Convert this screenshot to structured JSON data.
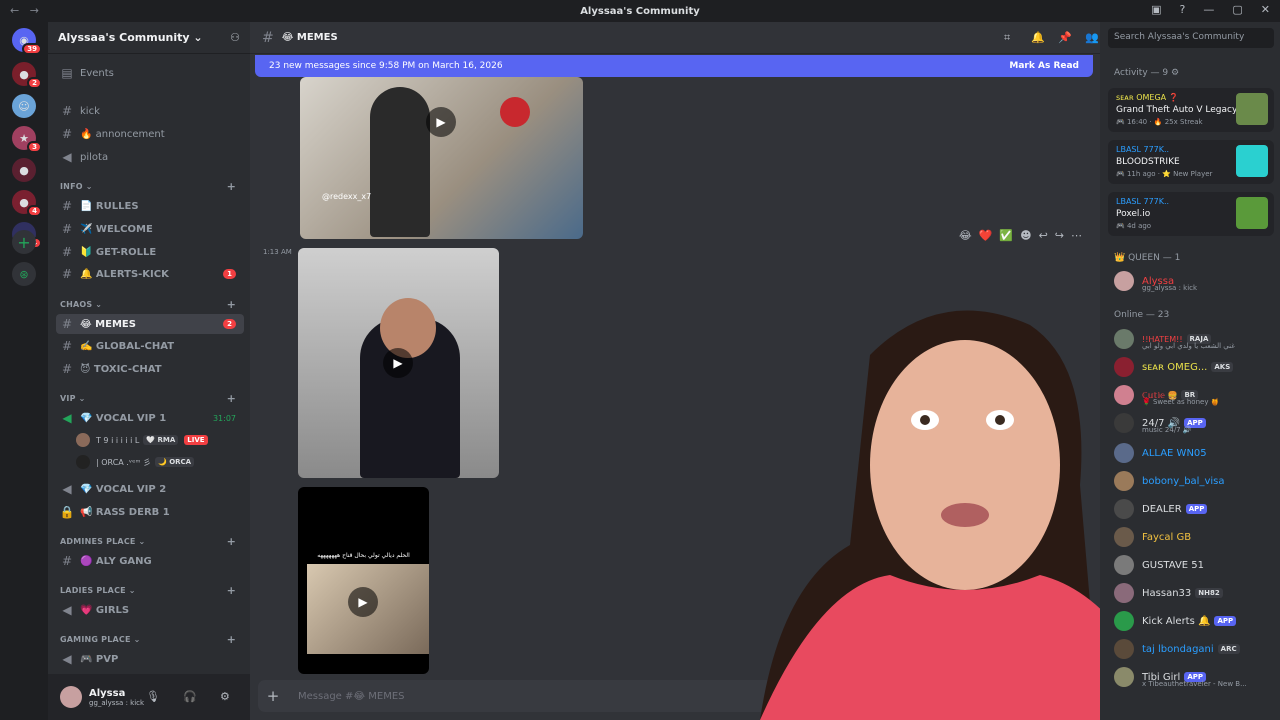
{
  "window": {
    "title": "Alyssaa's Community"
  },
  "server": {
    "name": "Alyssaa's Community ⌄"
  },
  "server_rail": {
    "badges": [
      "39",
      "2",
      "3",
      "4",
      "164"
    ]
  },
  "sidebar": {
    "events": "Events",
    "top_channels": [
      "kick",
      "🔥 annoncement",
      "pilota"
    ],
    "categories": {
      "info": "INFO ⌄",
      "chaos": "CHAOS ⌄",
      "vip": "VIP ⌄",
      "admins": "ADMINES PLACE ⌄",
      "ladies": "LADIES PLACE ⌄",
      "gaming": "GAMING PLACE ⌄"
    },
    "info_channels": [
      "📄 RULLES",
      "✈️ WELCOME",
      "🔰 GET-ROLLE",
      "🔔 ALERTS-KICK"
    ],
    "alerts_count": "1",
    "chaos_channels": [
      "😂 MEMES",
      "✍️ GLOBAL-CHAT",
      "😈 TOXIC-CHAT"
    ],
    "memes_count": "2",
    "vip_channels": [
      "💎 VOCAL VIP 1",
      "💎 VOCAL VIP 2",
      "📢 RASS DERB 1"
    ],
    "vip1_time": "31:07",
    "voice_users": [
      {
        "name": "T 9 i i i i i L",
        "tag": "🤍 RMA",
        "live": "LIVE"
      },
      {
        "name": "| ORCA .ᵛᵉᵐ 彡",
        "tag": "🌙 ORCA"
      }
    ],
    "admin_channel": "🟣 ALY GANG",
    "ladies_channel": "💗 GIRLS",
    "gaming_channel": "🎮 PVP"
  },
  "user": {
    "name": "Alyssa",
    "status": "gg_alyssa : kick"
  },
  "channel": {
    "name": "😂 MEMES",
    "new_messages": "23 new messages since 9:58 PM on March 16, 2026",
    "mark_read": "Mark As Read"
  },
  "messages": {
    "time": "1:13 AM",
    "watermark": "@redexx_x7",
    "caption": "الحلم ديالي تولي بحال قناح هههههههه",
    "reactions": [
      "😂",
      "❤️",
      "✅"
    ]
  },
  "composer": {
    "placeholder": "Message #😂 MEMES"
  },
  "search": {
    "placeholder": "Search Alyssaa's Community"
  },
  "activity": {
    "header": "Activity — 9 ⚙",
    "cards": [
      {
        "name": "ꜱᴇᴀʀ OMEGA ❓",
        "game": "Grand Theft Auto V Legacy",
        "sub": "🎮 16:40 · 🔥 25x Streak"
      },
      {
        "name": "LBASL 777K..",
        "game": "BLOODSTRIKE",
        "sub": "🎮 11h ago · ⭐ New Player"
      },
      {
        "name": "LBASL 777K..",
        "game": "Poxel.io",
        "sub": "🎮 4d ago"
      }
    ]
  },
  "members": {
    "queen_header": "👑 QUEEN — 1",
    "queen": {
      "name": "Alyssa",
      "status": "gg_alyssa : kick"
    },
    "online_header": "Online — 23",
    "online": [
      {
        "name": "!!HATEM!!",
        "tag": "RAJA",
        "status": "غني الشعب يا ولدي ابي ولو ابي"
      },
      {
        "name": "ꜱᴇᴀʀ OMEG...",
        "tag": "AKS"
      },
      {
        "name": "ℂ𝕦𝕥𝕚𝕖 🍔",
        "tag": "BR",
        "status": "🌹 Sweet as honey 🍯"
      },
      {
        "name": "24/7 🔊",
        "app": "APP",
        "status": "music 24/7 🔊"
      },
      {
        "name": "ALLAE WN05"
      },
      {
        "name": "bobony_bal_visa"
      },
      {
        "name": "DEALER",
        "app": "APP"
      },
      {
        "name": "Faycal GB"
      },
      {
        "name": "GUSTAVE 51"
      },
      {
        "name": "Hassan33",
        "tag": "NH82"
      },
      {
        "name": "Kick Alerts 🔔",
        "app": "APP"
      },
      {
        "name": "taj lbondagani",
        "tag": "ARC"
      },
      {
        "name": "Tibi Girl",
        "app": "APP",
        "status": "x Tibeauthetraveler - New B..."
      }
    ]
  },
  "colors": {
    "accent": "#5865f2",
    "danger": "#f23f42",
    "online": "#23a55a"
  }
}
